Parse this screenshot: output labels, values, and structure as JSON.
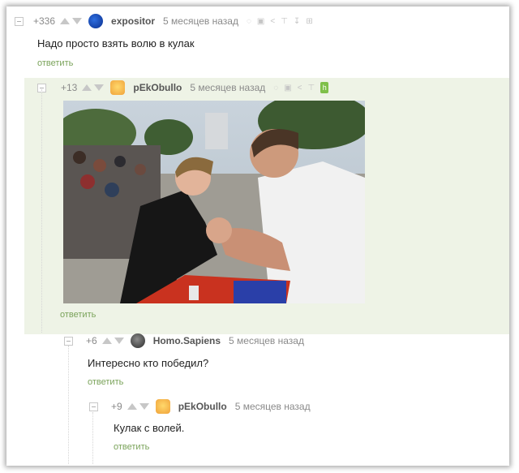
{
  "comments": [
    {
      "rating": "+336",
      "nick": "expositor",
      "time": "5 месяцев назад",
      "text": "Надо просто взять волю в кулак",
      "reply": "ответить"
    },
    {
      "rating": "+13",
      "nick": "pEkObullo",
      "time": "5 месяцев назад",
      "text": "",
      "reply": "ответить"
    },
    {
      "rating": "+6",
      "nick": "Homo.Sapiens",
      "time": "5 месяцев назад",
      "text": "Интересно кто победил?",
      "reply": "ответить"
    },
    {
      "rating": "+9",
      "nick": "pEkObullo",
      "time": "5 месяцев назад",
      "text": "Кулак с волей.",
      "reply": "ответить"
    }
  ],
  "colors": {
    "accent_green": "#7aa35a",
    "highlight_bg": "#eef3e6",
    "bolt": "#7fc04a"
  },
  "icons": [
    "arrow-up-icon",
    "arrow-down-icon",
    "link-icon",
    "save-icon",
    "share-icon",
    "pin-icon",
    "download-icon",
    "bolt-icon"
  ]
}
